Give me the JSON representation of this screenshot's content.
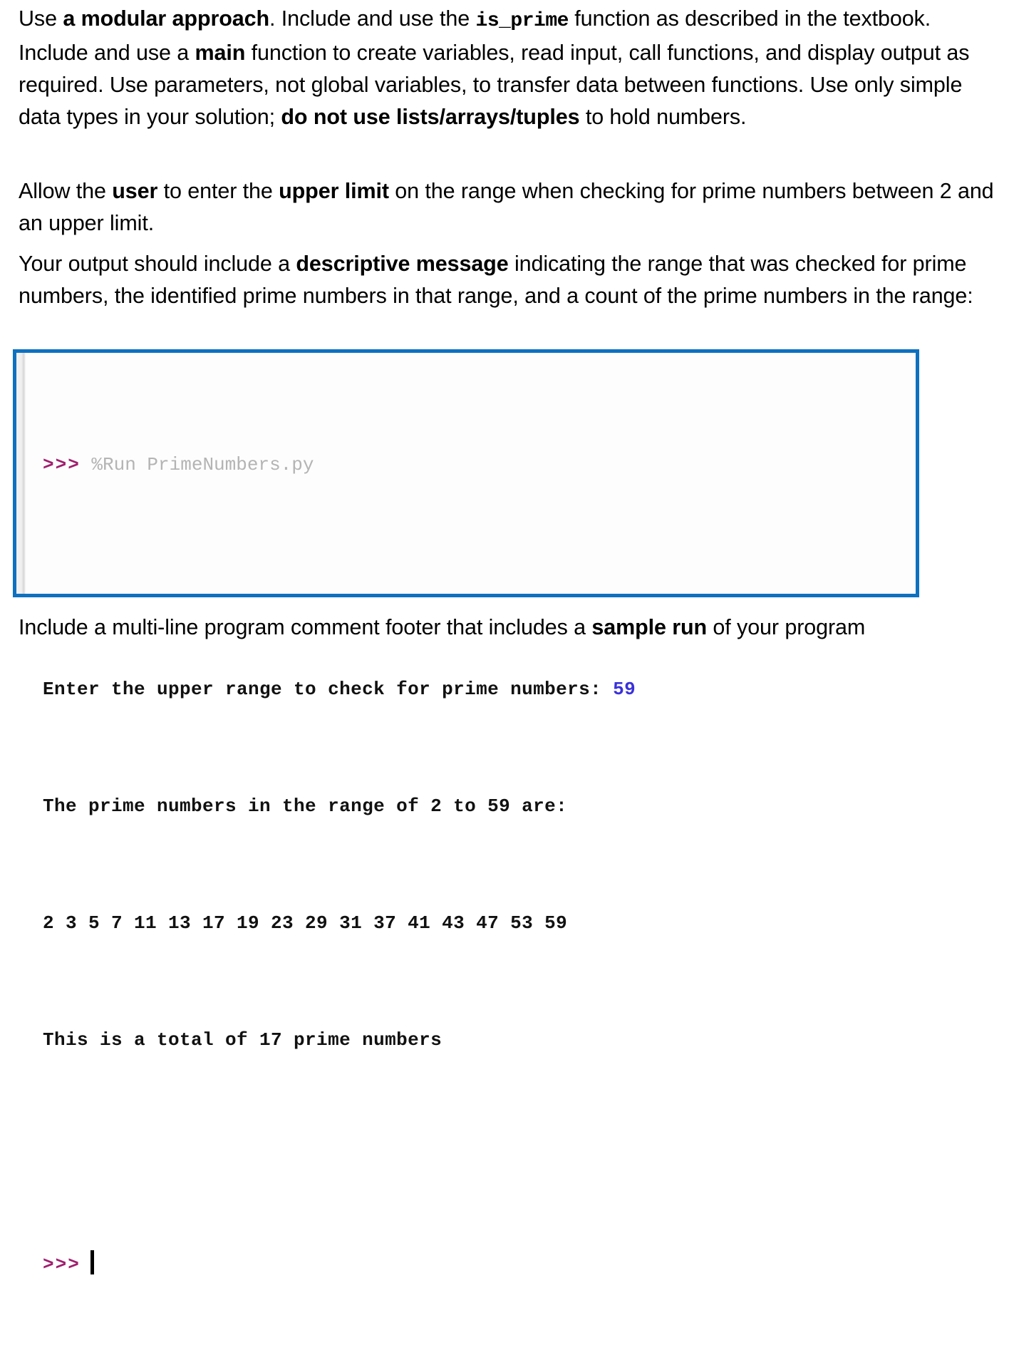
{
  "document": {
    "type": "assignment-instructions-slide",
    "accent_color": "#0d71c0",
    "paragraphs": {
      "p1": {
        "seg1": "Use ",
        "bold1": "a modular approach",
        "seg2": ".  Include and use the ",
        "mono1": "is_prime",
        "seg3": " function as described in the textbook.  Include and use a ",
        "bold2": "main",
        "seg4": " function to create variables, read input, call functions, and display output as required.  Use parameters, not global variables, to transfer data between functions.  Use only simple data types in your solution; ",
        "bold3": "do not use lists/arrays/tuples",
        "seg5": " to hold numbers."
      },
      "p2": {
        "seg1": "Allow the ",
        "bold1": "user",
        "seg2": " to enter the ",
        "bold2": "upper limit",
        "seg3": " on the range when checking for prime numbers between 2 and an upper limit."
      },
      "p3": {
        "seg1": "Your output should include a ",
        "bold1": "descriptive message",
        "seg2": " indicating the range that was checked for prime numbers, the identified prime numbers in that range, and a count of the prime numbers in the range:"
      },
      "p4": {
        "seg1": "Include a multi-line program comment footer that includes a ",
        "bold1": "sample run",
        "seg2": " of your program"
      }
    }
  },
  "shell": {
    "border_color": "#0d71c0",
    "background": "#fdfdfd",
    "prompt_color": "#a01e6e",
    "run_command_color": "#b4b4b4",
    "output_color": "#111111",
    "input_echo_color": "#3a31d8",
    "prompt_symbol": ">>>",
    "run_command": "%Run PrimeNumbers.py",
    "line_enter_prompt": "Enter the upper range to check for prime numbers: ",
    "line_enter_value": "59",
    "line_range_header": "The prime numbers in the range of 2 to 59 are:",
    "line_primes": "2 3 5 7 11 13 17 19 23 29 31 37 41 43 47 53 59",
    "line_total": "This is a total of 17 prime numbers",
    "upper_limit": "59",
    "prime_count": "17",
    "script_name": "PrimeNumbers.py",
    "cursor_visible": "true"
  }
}
